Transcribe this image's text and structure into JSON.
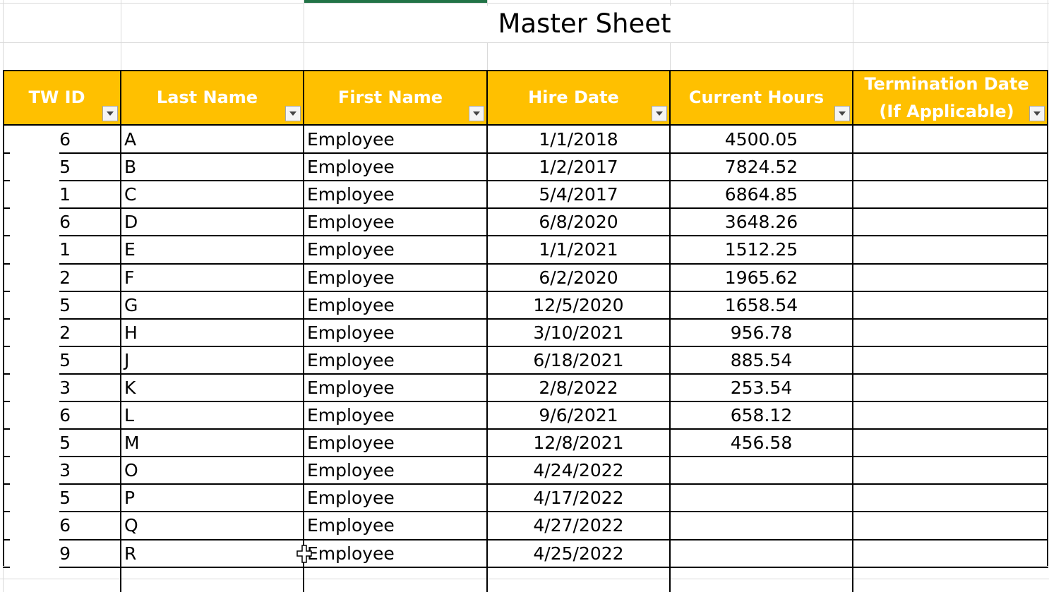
{
  "sheet": {
    "title": "Master Sheet",
    "columns": [
      {
        "label": "TW ID"
      },
      {
        "label": "Last Name"
      },
      {
        "label": "First Name"
      },
      {
        "label": "Hire Date"
      },
      {
        "label": "Current Hours"
      },
      {
        "label": "Termination Date (If Applicable)"
      }
    ],
    "rows": [
      {
        "id": "6",
        "last": "A",
        "first": "Employee",
        "hire": "1/1/2018",
        "hours": "4500.05",
        "term": ""
      },
      {
        "id": "5",
        "last": "B",
        "first": "Employee",
        "hire": "1/2/2017",
        "hours": "7824.52",
        "term": ""
      },
      {
        "id": "1",
        "last": "C",
        "first": "Employee",
        "hire": "5/4/2017",
        "hours": "6864.85",
        "term": ""
      },
      {
        "id": "6",
        "last": "D",
        "first": "Employee",
        "hire": "6/8/2020",
        "hours": "3648.26",
        "term": ""
      },
      {
        "id": "1",
        "last": "E",
        "first": "Employee",
        "hire": "1/1/2021",
        "hours": "1512.25",
        "term": ""
      },
      {
        "id": "2",
        "last": "F",
        "first": "Employee",
        "hire": "6/2/2020",
        "hours": "1965.62",
        "term": ""
      },
      {
        "id": "5",
        "last": "G",
        "first": "Employee",
        "hire": "12/5/2020",
        "hours": "1658.54",
        "term": ""
      },
      {
        "id": "2",
        "last": "H",
        "first": "Employee",
        "hire": "3/10/2021",
        "hours": "956.78",
        "term": ""
      },
      {
        "id": "5",
        "last": "J",
        "first": "Employee",
        "hire": "6/18/2021",
        "hours": "885.54",
        "term": ""
      },
      {
        "id": "3",
        "last": "K",
        "first": "Employee",
        "hire": "2/8/2022",
        "hours": "253.54",
        "term": ""
      },
      {
        "id": "6",
        "last": "L",
        "first": "Employee",
        "hire": "9/6/2021",
        "hours": "658.12",
        "term": ""
      },
      {
        "id": "5",
        "last": "M",
        "first": "Employee",
        "hire": "12/8/2021",
        "hours": "456.58",
        "term": ""
      },
      {
        "id": "3",
        "last": "O",
        "first": "Employee",
        "hire": "4/24/2022",
        "hours": "",
        "term": ""
      },
      {
        "id": "5",
        "last": "P",
        "first": "Employee",
        "hire": "4/17/2022",
        "hours": "",
        "term": ""
      },
      {
        "id": "6",
        "last": "Q",
        "first": "Employee",
        "hire": "4/27/2022",
        "hours": "",
        "term": ""
      },
      {
        "id": "9",
        "last": "R",
        "first": "Employee",
        "hire": "4/25/2022",
        "hours": "",
        "term": ""
      }
    ]
  },
  "theme": {
    "header_fill": "#ffc000",
    "header_text": "#ffffff",
    "selection_accent": "#217346",
    "gridline": "#d9d9d9"
  },
  "icons": {
    "filter": "filter-dropdown-icon",
    "cursor": "cell-select-cross-cursor-icon"
  }
}
